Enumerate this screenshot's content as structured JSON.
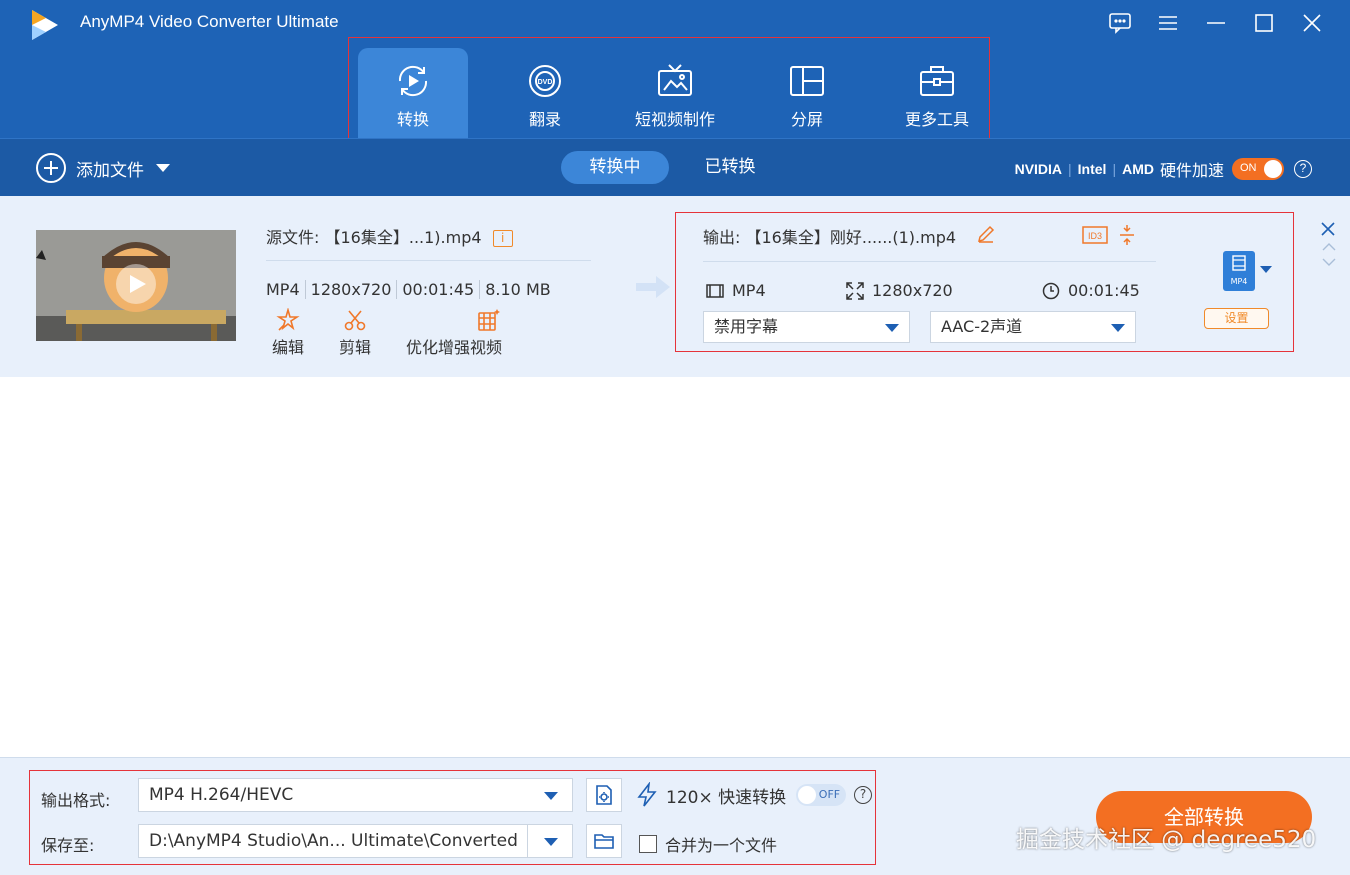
{
  "app": {
    "title": "AnyMP4 Video Converter Ultimate"
  },
  "nav": {
    "tabs": [
      {
        "label": "转换",
        "icon": "convert-icon",
        "active": true
      },
      {
        "label": "翻录",
        "icon": "dvd-icon"
      },
      {
        "label": "短视频制作",
        "icon": "tv-icon"
      },
      {
        "label": "分屏",
        "icon": "split-screen-icon"
      },
      {
        "label": "更多工具",
        "icon": "toolbox-icon"
      }
    ]
  },
  "toolbar": {
    "add_file": "添加文件",
    "segments": {
      "converting": "转换中",
      "converted": "已转换"
    },
    "hw": {
      "nvidia": "NVIDIA",
      "intel": "Intel",
      "amd": "AMD",
      "accel_label": "硬件加速",
      "toggle": "ON"
    }
  },
  "file": {
    "source_label": "源文件:",
    "source_name": "【16集全】...1).mp4",
    "info": "i",
    "meta": {
      "format": "MP4",
      "resolution": "1280x720",
      "duration": "00:01:45",
      "size": "8.10 MB"
    },
    "actions": {
      "edit": "编辑",
      "cut": "剪辑",
      "enhance": "优化增强视频"
    },
    "output_label": "输出:",
    "output_name": "【16集全】刚好......(1).mp4",
    "out_meta": {
      "format": "MP4",
      "resolution": "1280x720",
      "duration": "00:01:45"
    },
    "subtitle": "禁用字幕",
    "audio": "AAC-2声道",
    "format_badge": "MP4",
    "settings": "设置"
  },
  "bottom": {
    "format_label": "输出格式:",
    "format_value": "MP4 H.264/HEVC",
    "speed": "120× 快速转换",
    "speed_toggle": "OFF",
    "save_label": "保存至:",
    "save_path": "D:\\AnyMP4 Studio\\An... Ultimate\\Converted",
    "merge": "合并为一个文件",
    "convert_all": "全部转换",
    "watermark": "掘金技术社区 @ degree520"
  },
  "colors": {
    "primary": "#1e63b6",
    "accent": "#f36f22",
    "highlight_box": "#e5333a"
  }
}
